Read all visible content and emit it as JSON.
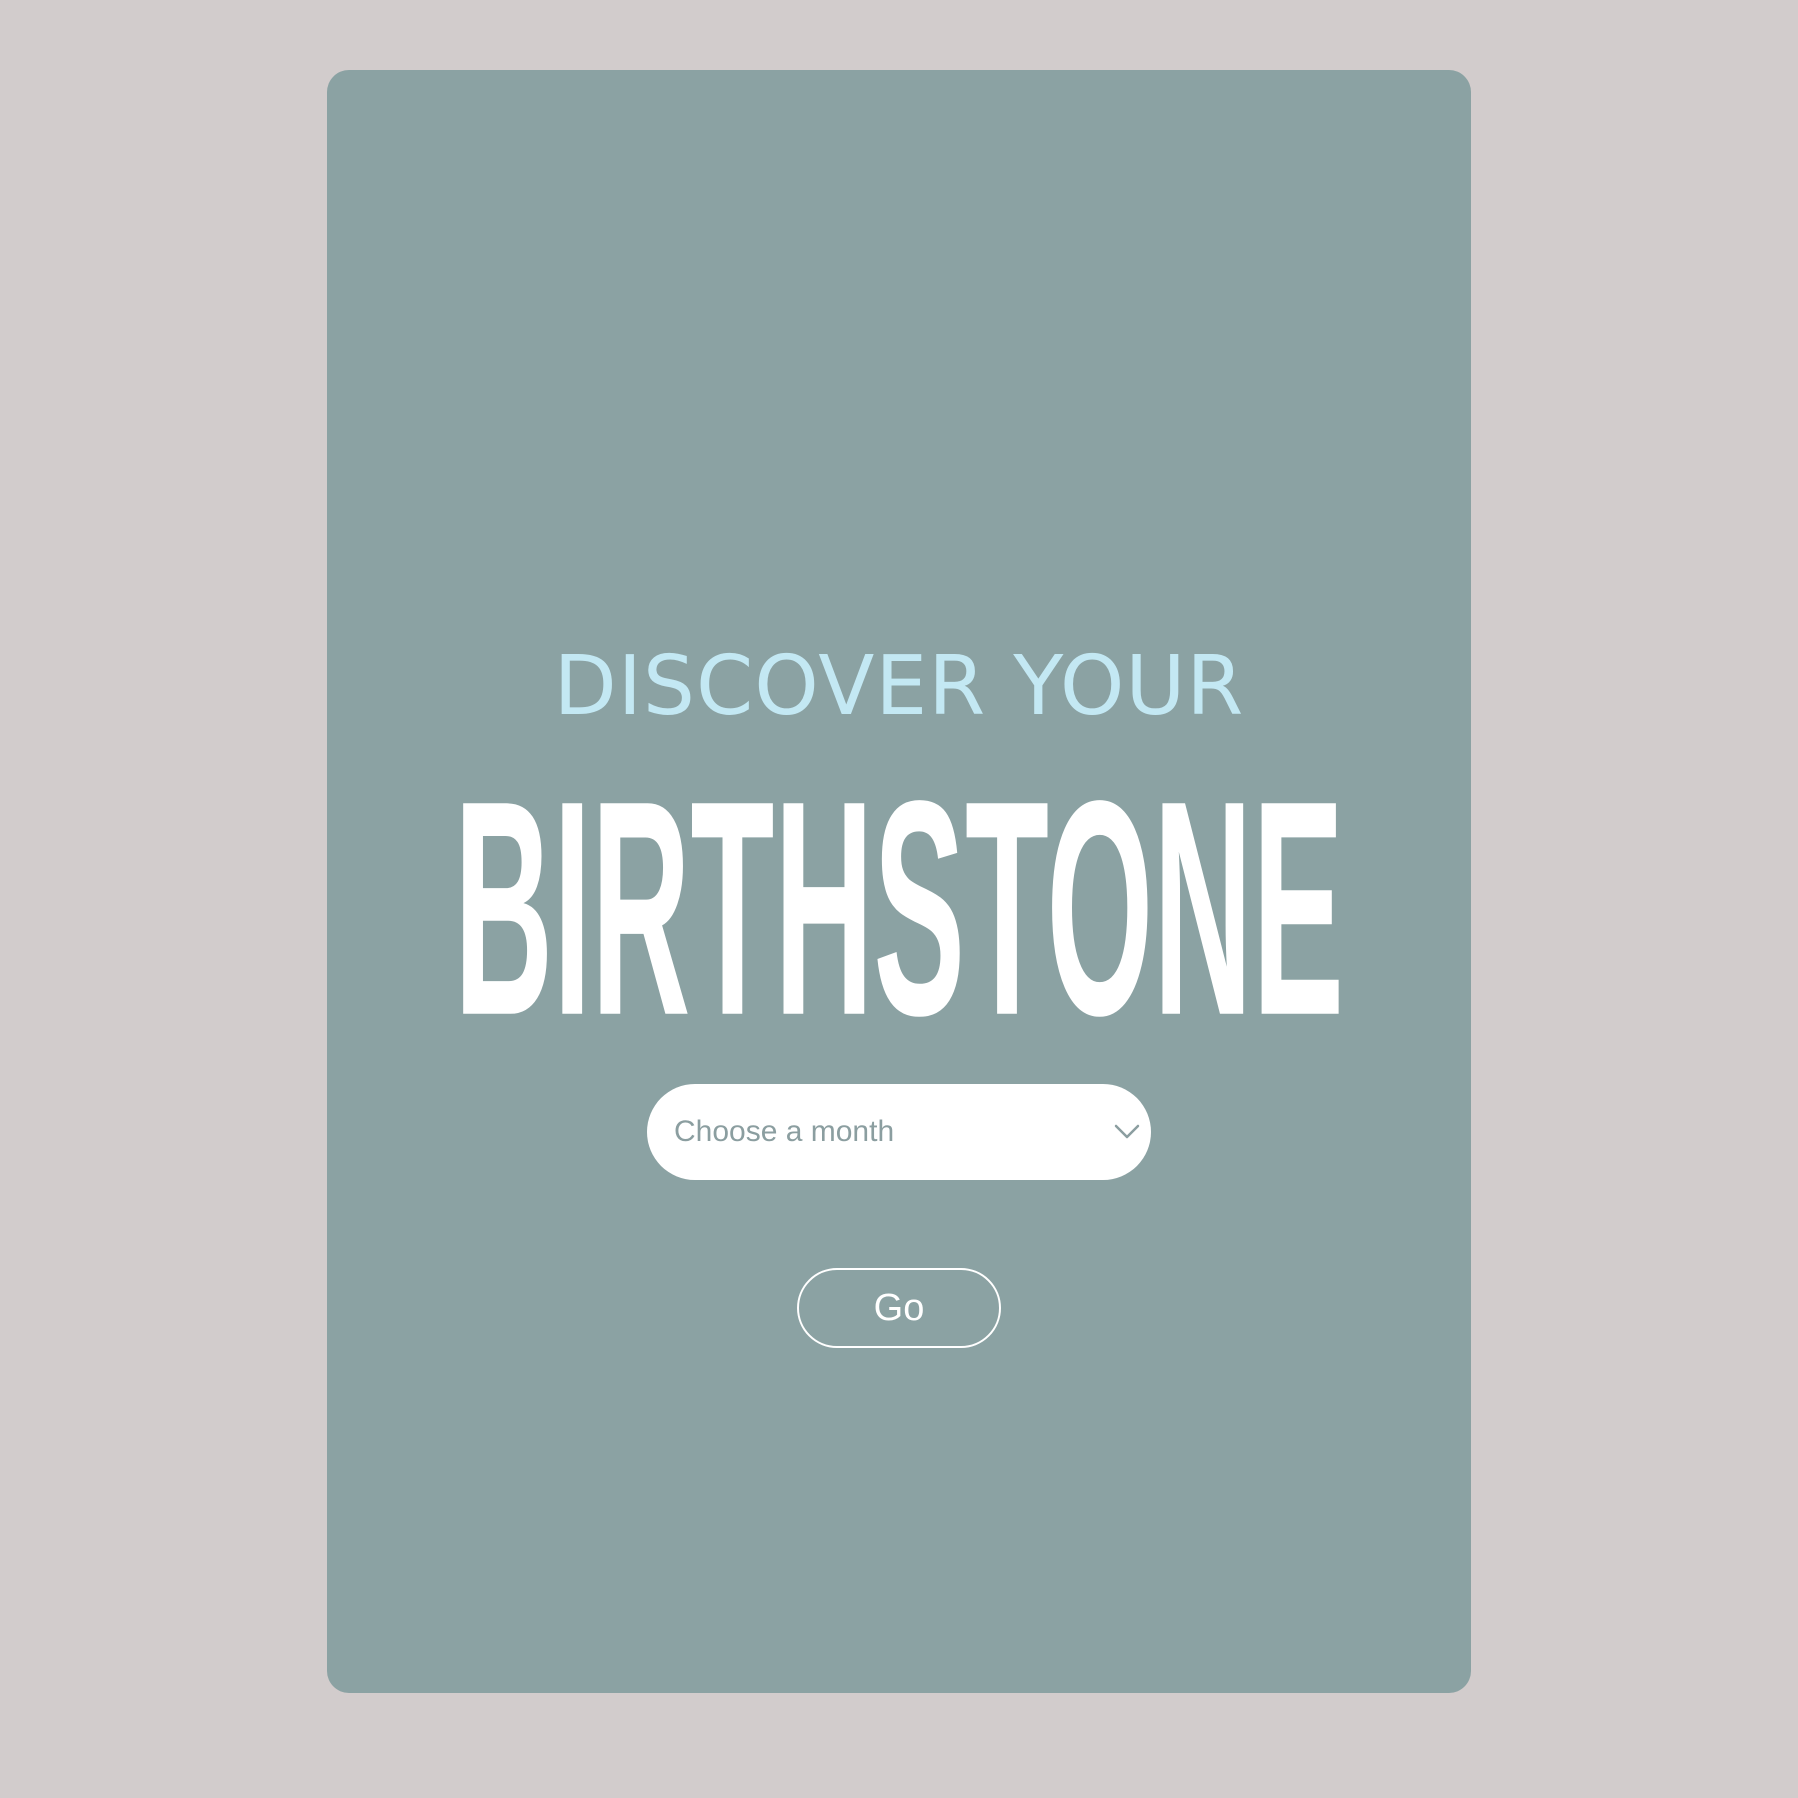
{
  "card": {
    "eyebrow": "DISCOVER YOUR",
    "headline": "BIRTHSTONE"
  },
  "month_select": {
    "placeholder": "Choose a month",
    "icon": "chevron-down-icon"
  },
  "go_button": {
    "label": "Go"
  },
  "colors": {
    "page_background": "#d2cccc",
    "card_background": "#8ba2a3",
    "eyebrow_text": "#c3e8f3",
    "headline_text": "#ffffff",
    "select_background": "#ffffff",
    "select_text": "#8b9ea0"
  }
}
